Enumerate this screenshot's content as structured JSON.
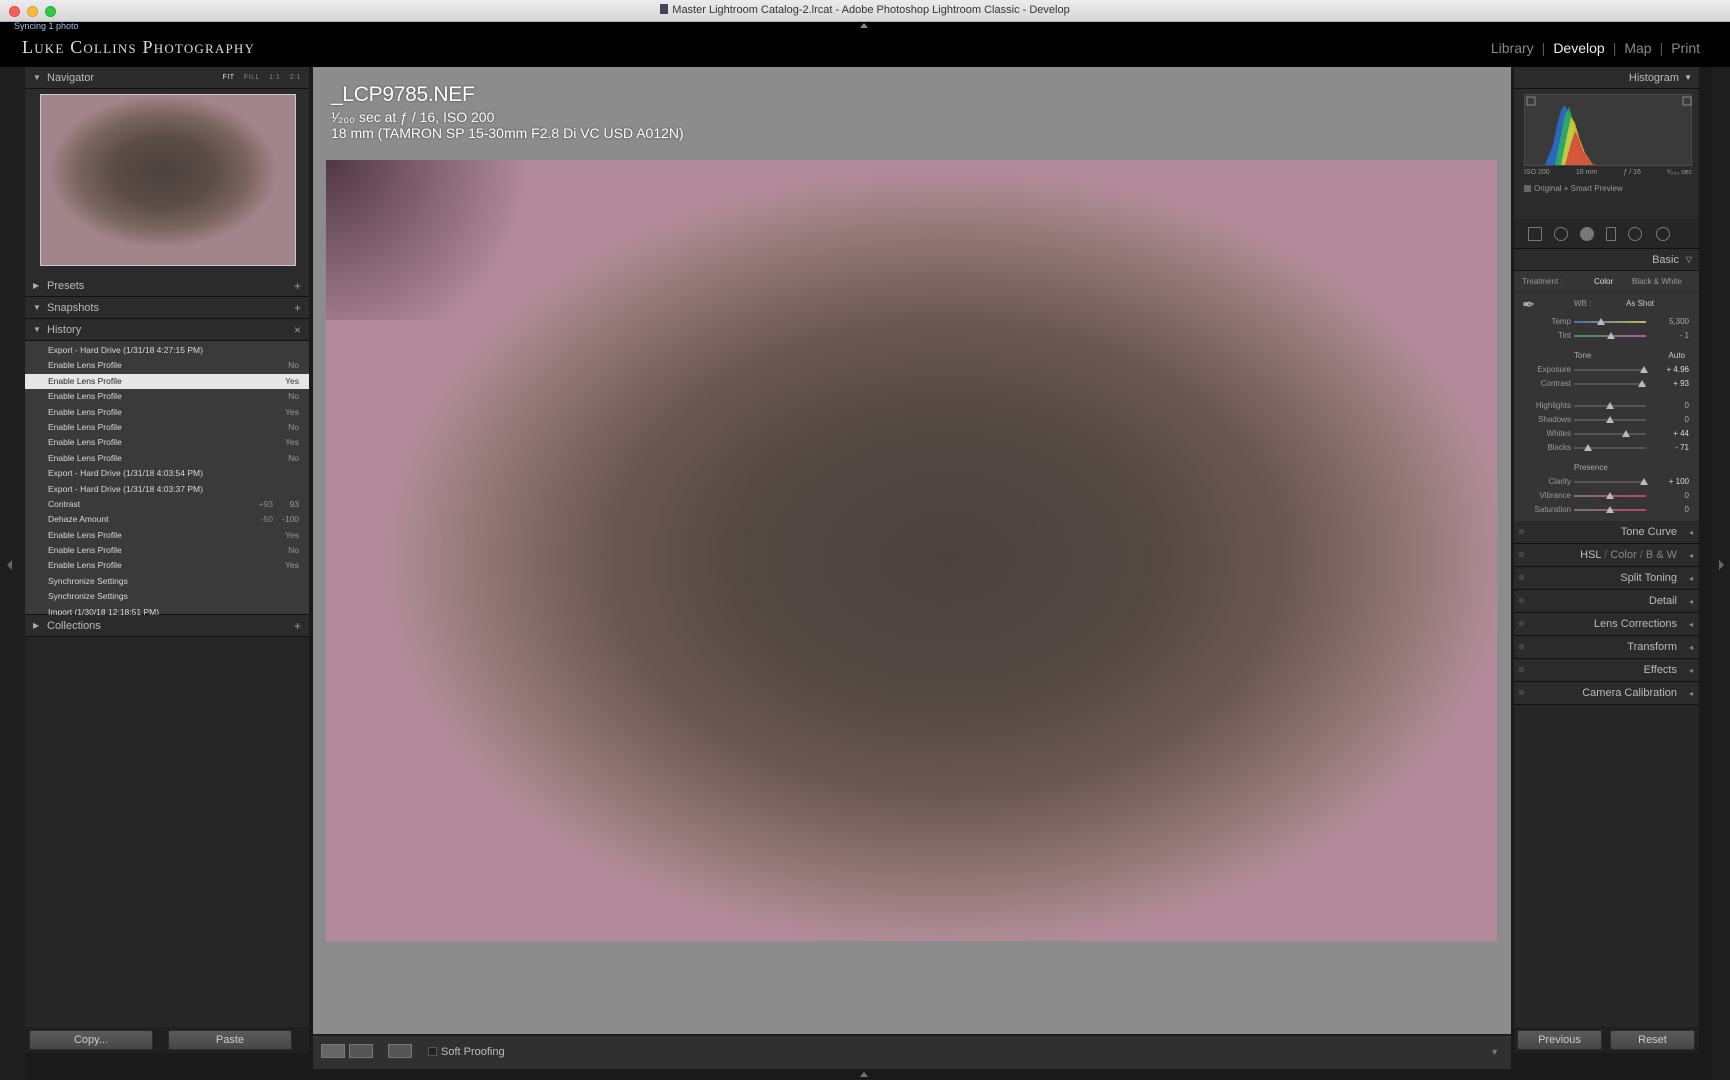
{
  "window": {
    "title": "Master Lightroom Catalog-2.lrcat - Adobe Photoshop Lightroom Classic - Develop",
    "sync_status": "Syncing 1 photo"
  },
  "identity": {
    "brand": "Luke Collins Photography",
    "modules": [
      {
        "label": "Library",
        "active": false
      },
      {
        "label": "Develop",
        "active": true
      },
      {
        "label": "Map",
        "active": false
      },
      {
        "label": "Print",
        "active": false
      }
    ]
  },
  "left": {
    "navigator": {
      "title": "Navigator",
      "zoom": {
        "fit": "FIT",
        "fill": "FILL",
        "one": "1:1",
        "two": "2:1"
      }
    },
    "presets": {
      "title": "Presets"
    },
    "snapshots": {
      "title": "Snapshots"
    },
    "history": {
      "title": "History",
      "rows": [
        {
          "label": "Export - Hard Drive (1/31/18 4:27:15 PM)",
          "from": "",
          "to": "",
          "selected": false
        },
        {
          "label": "Enable Lens Profile",
          "from": "",
          "to": "No",
          "selected": false
        },
        {
          "label": "Enable Lens Profile",
          "from": "",
          "to": "Yes",
          "selected": true
        },
        {
          "label": "Enable Lens Profile",
          "from": "",
          "to": "No",
          "selected": false
        },
        {
          "label": "Enable Lens Profile",
          "from": "",
          "to": "Yes",
          "selected": false
        },
        {
          "label": "Enable Lens Profile",
          "from": "",
          "to": "No",
          "selected": false
        },
        {
          "label": "Enable Lens Profile",
          "from": "",
          "to": "Yes",
          "selected": false
        },
        {
          "label": "Enable Lens Profile",
          "from": "",
          "to": "No",
          "selected": false
        },
        {
          "label": "Export - Hard Drive (1/31/18 4:03:54 PM)",
          "from": "",
          "to": "",
          "selected": false
        },
        {
          "label": "Export - Hard Drive (1/31/18 4:03:37 PM)",
          "from": "",
          "to": "",
          "selected": false
        },
        {
          "label": "Contrast",
          "from": "+93",
          "to": "93",
          "selected": false
        },
        {
          "label": "Dehaze Amount",
          "from": "-50",
          "to": "-100",
          "selected": false
        },
        {
          "label": "Enable Lens Profile",
          "from": "",
          "to": "Yes",
          "selected": false
        },
        {
          "label": "Enable Lens Profile",
          "from": "",
          "to": "No",
          "selected": false
        },
        {
          "label": "Enable Lens Profile",
          "from": "",
          "to": "Yes",
          "selected": false
        },
        {
          "label": "Synchronize Settings",
          "from": "",
          "to": "",
          "selected": false
        },
        {
          "label": "Synchronize Settings",
          "from": "",
          "to": "",
          "selected": false
        },
        {
          "label": "Import (1/30/18 12:18:51 PM)",
          "from": "",
          "to": "",
          "selected": false
        }
      ]
    },
    "collections": {
      "title": "Collections"
    },
    "copy_label": "Copy...",
    "paste_label": "Paste"
  },
  "center": {
    "filename": "_LCP9785.NEF",
    "exposure_line": "¹⁄₂₀₀ sec at ƒ / 16, ISO 200",
    "lens_line": "18 mm (TAMRON SP 15-30mm F2.8 Di VC USD A012N)",
    "soft_proofing": "Soft Proofing"
  },
  "right": {
    "histogram": {
      "title": "Histogram",
      "iso": "ISO 200",
      "focal": "18 mm",
      "aperture": "ƒ / 16",
      "shutter": "¹⁄₂₀₀ sec",
      "preview": "Original + Smart Preview"
    },
    "basic": {
      "title": "Basic",
      "treatment_label": "Treatment :",
      "treatment_color": "Color",
      "treatment_bw": "Black & White",
      "wb_label": "WB :",
      "wb_value": "As Shot",
      "temp_label": "Temp",
      "temp_value": "5,300",
      "tint_label": "Tint",
      "tint_value": "- 1",
      "tone_label": "Tone",
      "auto_label": "Auto",
      "exposure_label": "Exposure",
      "exposure_value": "+ 4.96",
      "contrast_label": "Contrast",
      "contrast_value": "+ 93",
      "highlights_label": "Highlights",
      "highlights_value": "0",
      "shadows_label": "Shadows",
      "shadows_value": "0",
      "whites_label": "Whites",
      "whites_value": "+ 44",
      "blacks_label": "Blacks",
      "blacks_value": "- 71",
      "presence_label": "Presence",
      "clarity_label": "Clarity",
      "clarity_value": "+ 100",
      "vibrance_label": "Vibrance",
      "vibrance_value": "0",
      "saturation_label": "Saturation",
      "saturation_value": "0"
    },
    "collapsed_panels": {
      "tone_curve": "Tone Curve",
      "hsl": "HSL",
      "color": "Color",
      "bw": "B & W",
      "split_toning": "Split Toning",
      "detail": "Detail",
      "lens_corrections": "Lens Corrections",
      "transform": "Transform",
      "effects": "Effects",
      "camera_calibration": "Camera Calibration"
    },
    "previous_label": "Previous",
    "reset_label": "Reset"
  },
  "colors": {
    "panel_bg": "#262626",
    "canvas_bg": "#8c8c8c",
    "history_selected": "#e6e6e6"
  }
}
